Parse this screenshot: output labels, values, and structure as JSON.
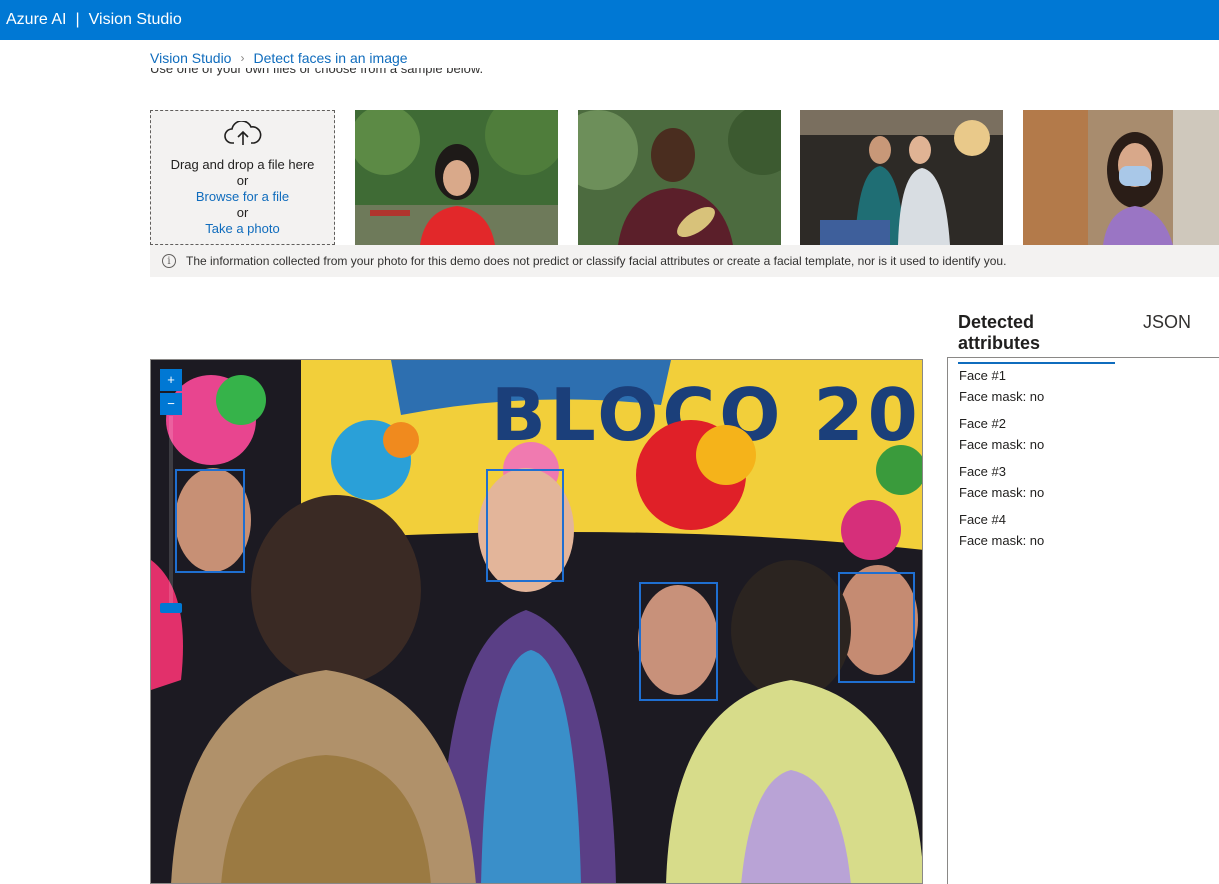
{
  "header": {
    "brand": "Azure AI",
    "product": "Vision Studio"
  },
  "breadcrumb": {
    "root": "Vision Studio",
    "current": "Detect faces in an image"
  },
  "intro_text": "Use one of your own files or choose from a sample below.",
  "upload": {
    "drag_text": "Drag and drop a file here",
    "or1": "or",
    "browse": "Browse for a file",
    "or2": "or",
    "camera": "Take a photo"
  },
  "samples": [
    "sample-woman-red-top",
    "sample-man-purple-shirt",
    "sample-two-women-office",
    "sample-woman-face-mask"
  ],
  "notice": "The information collected from your photo for this demo does not predict or classify facial attributes or create a facial template, nor is it used to identify you.",
  "tabs": {
    "detected": "Detected attributes",
    "json": "JSON"
  },
  "faces": [
    {
      "title": "Face #1",
      "mask": "Face mask: no"
    },
    {
      "title": "Face #2",
      "mask": "Face mask: no"
    },
    {
      "title": "Face #3",
      "mask": "Face mask: no"
    },
    {
      "title": "Face #4",
      "mask": "Face mask: no"
    }
  ],
  "zoom": {
    "in": "+",
    "out": "−"
  },
  "colors": {
    "accent": "#0078d4",
    "link": "#0f6cbd",
    "facebox": "#1f6fd1"
  }
}
